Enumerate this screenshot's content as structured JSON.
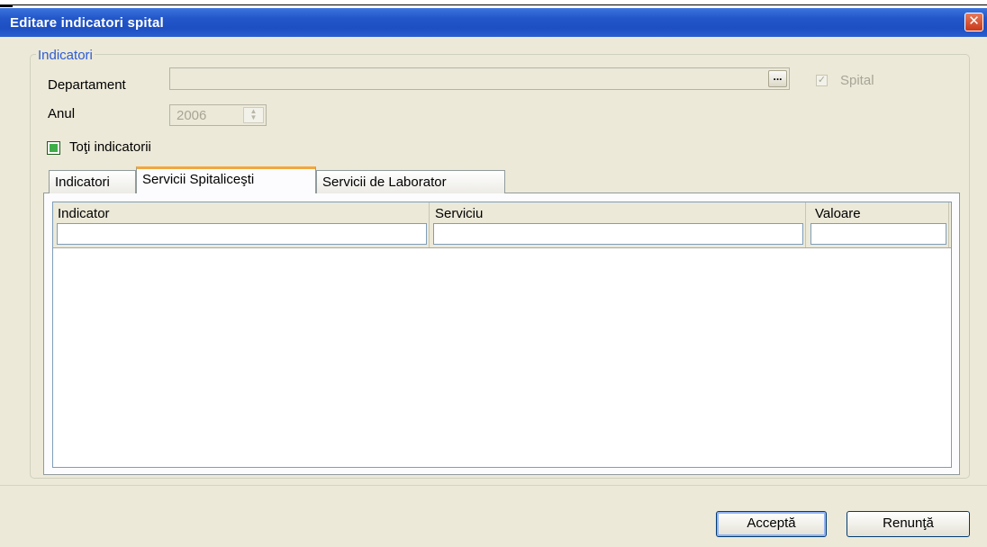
{
  "window": {
    "title": "Editare indicatori spital",
    "close_symbol": "✕"
  },
  "group": {
    "legend": "Indicatori"
  },
  "form": {
    "departament_label": "Departament",
    "departament_value": "",
    "ellipsis_label": "...",
    "spital_label": "Spital",
    "spital_checked": true,
    "anul_label": "Anul",
    "anul_value": "2006",
    "toti_indicatorii_label": "Toţi indicatorii"
  },
  "tabs": [
    {
      "label": "Indicatori",
      "active": false
    },
    {
      "label": "Servicii Spitaliceşti",
      "active": true
    },
    {
      "label": "Servicii de Laborator",
      "active": false
    }
  ],
  "grid": {
    "columns": [
      "Indicator",
      "Serviciu",
      "Valoare"
    ],
    "rows": []
  },
  "buttons": {
    "accept": "Acceptă",
    "cancel": "Renunţă"
  },
  "colors": {
    "titlebar": "#2357c9",
    "window_bg": "#ece9d8",
    "group_legend": "#2d5bd2",
    "active_tab_accent": "#f2a73d"
  }
}
